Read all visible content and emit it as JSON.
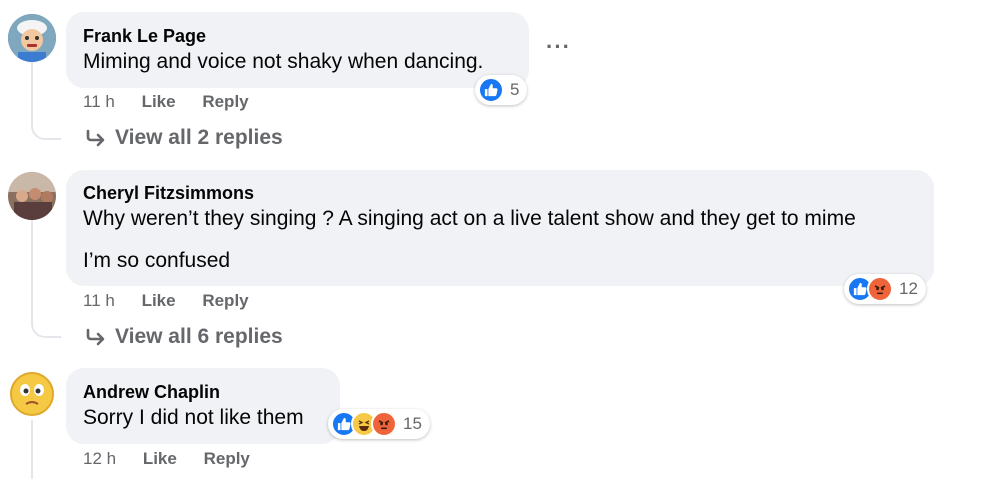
{
  "comments": [
    {
      "author": "Frank Le Page",
      "text": "Miming and voice not shaky when dancing.",
      "time": "11 h",
      "like_label": "Like",
      "reply_label": "Reply",
      "reaction_count": "5",
      "reactions": [
        "like"
      ],
      "view_replies": "View all 2 replies"
    },
    {
      "author": "Cheryl Fitzsimmons",
      "text_line1": "Why weren’t they singing ? A singing act on a live talent show and they get to mime",
      "text_line2": "I’m so confused",
      "time": "11 h",
      "like_label": "Like",
      "reply_label": "Reply",
      "reaction_count": "12",
      "reactions": [
        "like",
        "angry"
      ],
      "view_replies": "View all 6 replies"
    },
    {
      "author": "Andrew Chaplin",
      "text": "Sorry I did not like them",
      "time": "12 h",
      "like_label": "Like",
      "reply_label": "Reply",
      "reaction_count": "15",
      "reactions": [
        "like",
        "haha",
        "angry"
      ]
    }
  ],
  "colors": {
    "bubble": "#f0f2f5",
    "like_blue": "#1877f2",
    "angry_orange": "#f0643c",
    "haha_yellow": "#f7c948",
    "meta_gray": "#65676b"
  }
}
